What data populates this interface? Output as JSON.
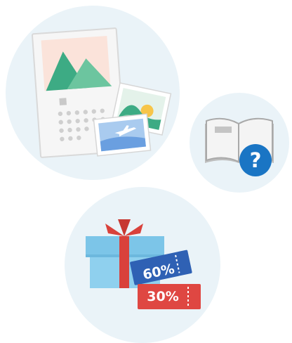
{
  "colors": {
    "circle_bg": "#eaf3f8",
    "paper": "#f6f6f6",
    "paper_border": "#d7d7d7",
    "photo_pink": "#fbe3da",
    "mountain_dark": "#3dab84",
    "mountain_light": "#6cc59f",
    "calendar_dots": "#cfcfcf",
    "sun": "#f7c548",
    "sky_blue": "#7fb2e5",
    "help_badge": "#1a75c4",
    "gift_box": "#8fd0ee",
    "gift_lid": "#7cc5e8",
    "ribbon_red": "#d9413b",
    "coupon_blue": "#2f61b4",
    "coupon_red": "#df4742"
  },
  "illustrations": {
    "photo_calendar": {
      "icon": "photo-calendar-icon"
    },
    "help_book": {
      "icon": "book-question-icon",
      "badge_glyph": "?"
    },
    "gift_coupons": {
      "icon": "gift-coupon-icon",
      "coupon_top": "60%",
      "coupon_bottom": "30%"
    }
  }
}
